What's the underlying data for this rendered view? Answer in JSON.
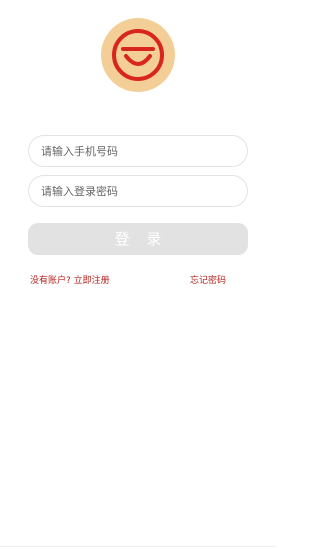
{
  "logo": {
    "icon": "smile-logo-icon",
    "background_color": "#F3CE96",
    "stroke_color": "#D8251E"
  },
  "login_form": {
    "phone_placeholder": "请输入手机号码",
    "password_placeholder": "请输入登录密码",
    "login_label": "登 录",
    "login_button_color": "#E2E2E2"
  },
  "links": {
    "register": "没有账户? 立即注册",
    "forgot_password": "忘记密码",
    "color": "#B3221F"
  }
}
